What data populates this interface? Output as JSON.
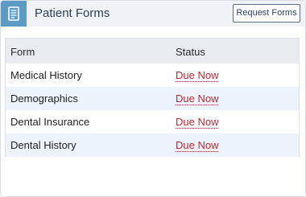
{
  "header": {
    "icon": "document-icon",
    "title": "Patient Forms",
    "request_button": "Request Forms"
  },
  "table": {
    "columns": [
      "Form",
      "Status"
    ],
    "rows": [
      {
        "form": "Medical History",
        "status": "Due Now"
      },
      {
        "form": "Demographics",
        "status": "Due Now"
      },
      {
        "form": "Dental Insurance",
        "status": "Due Now"
      },
      {
        "form": "Dental History",
        "status": "Due Now"
      }
    ]
  },
  "colors": {
    "header_icon_bg": "#5b9bc4",
    "status_due": "#c0242f",
    "row_alt_bg": "#edf3fc"
  }
}
